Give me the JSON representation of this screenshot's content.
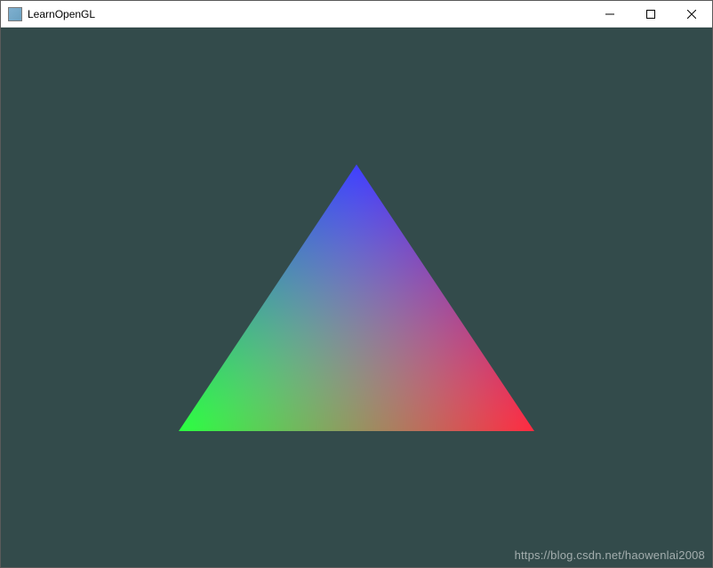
{
  "window": {
    "title": "LearnOpenGL",
    "icon": "app-icon"
  },
  "controls": {
    "minimize": "minimize",
    "maximize": "maximize",
    "close": "close"
  },
  "render": {
    "clear_color": "#334b4b",
    "triangle": {
      "vertices": [
        {
          "pos": "bottom-right",
          "color": "#ff0000"
        },
        {
          "pos": "bottom-left",
          "color": "#00ff00"
        },
        {
          "pos": "top",
          "color": "#0000ff"
        }
      ]
    }
  },
  "watermark": {
    "text": "https://blog.csdn.net/haowenlai2008"
  }
}
